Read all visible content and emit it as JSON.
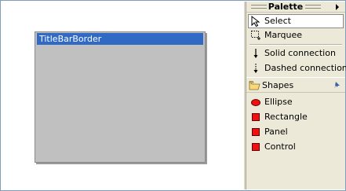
{
  "canvas": {
    "figure": {
      "title": "TitleBarBorder",
      "title_color": "#316ac5",
      "body_color": "#c0c0c0"
    }
  },
  "palette": {
    "title": "Palette",
    "tools": [
      {
        "label": "Select",
        "icon": "arrow-cursor-icon",
        "selected": true
      },
      {
        "label": "Marquee",
        "icon": "marquee-icon"
      },
      {
        "label": "Solid connection",
        "icon": "solid-connection-icon"
      },
      {
        "label": "Dashed connection",
        "icon": "dashed-connection-icon"
      }
    ],
    "drawer": {
      "label": "Shapes",
      "icon": "folder-icon",
      "pin_icon": "pin-icon",
      "items": [
        {
          "label": "Ellipse",
          "icon": "ellipse-icon"
        },
        {
          "label": "Rectangle",
          "icon": "rectangle-icon"
        },
        {
          "label": "Panel",
          "icon": "panel-icon"
        },
        {
          "label": "Control",
          "icon": "control-icon"
        }
      ]
    },
    "accent_red": "#e11111"
  }
}
